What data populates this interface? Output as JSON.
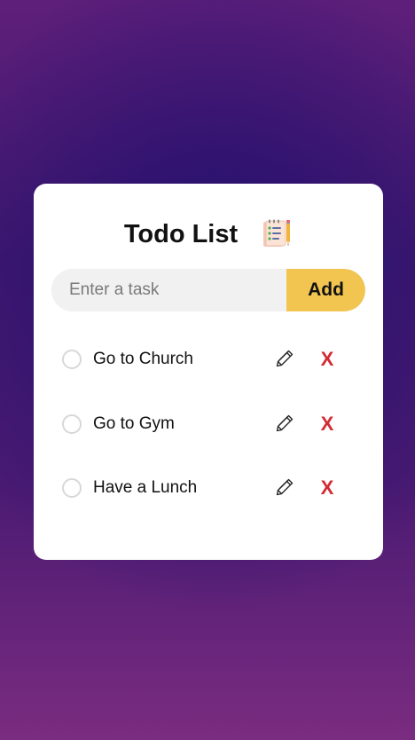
{
  "app": {
    "title": "Todo List",
    "title_icon": "notepad-pencil-icon"
  },
  "input": {
    "value": "",
    "placeholder": "Enter a task",
    "add_label": "Add"
  },
  "tasks": [
    {
      "text": "Go to Church",
      "done": false,
      "edit_icon": "pencil-icon",
      "delete_label": "X"
    },
    {
      "text": "Go to Gym",
      "done": false,
      "edit_icon": "pencil-icon",
      "delete_label": "X"
    },
    {
      "text": "Have a Lunch",
      "done": false,
      "edit_icon": "pencil-icon",
      "delete_label": "X"
    }
  ],
  "colors": {
    "accent": "#f2c551",
    "delete": "#d42a34",
    "card": "#ffffff",
    "input_bg": "#f1f1f1",
    "bg_dark": "#22106e",
    "bg_edge": "#7a2c80"
  }
}
